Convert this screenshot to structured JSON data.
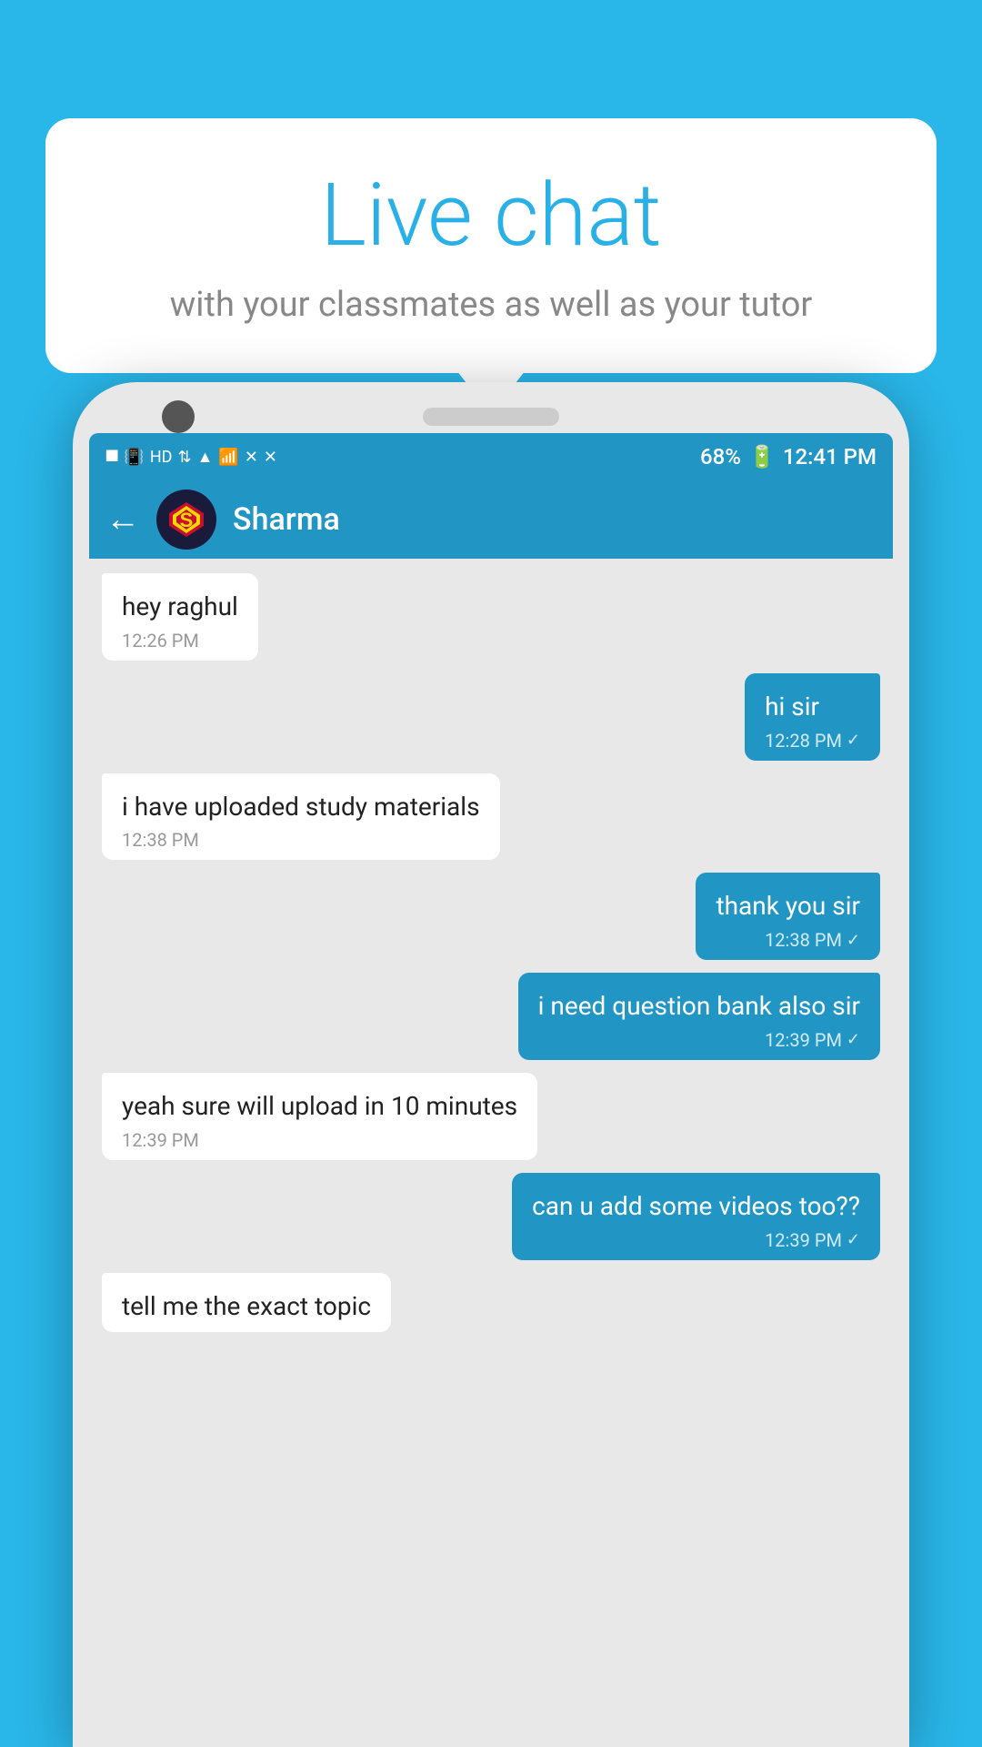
{
  "background_color": "#29b6e8",
  "speech_bubble": {
    "title": "Live chat",
    "subtitle": "with your classmates as well as your tutor"
  },
  "phone": {
    "status_bar": {
      "time": "12:41 PM",
      "battery": "68%",
      "icons": [
        "bluetooth",
        "vibrate",
        "HD",
        "wifi",
        "signal",
        "battery"
      ]
    },
    "chat_header": {
      "contact_name": "Sharma",
      "back_label": "←"
    },
    "messages": [
      {
        "id": 1,
        "type": "received",
        "text": "hey raghul",
        "time": "12:26 PM",
        "check": false
      },
      {
        "id": 2,
        "type": "sent",
        "text": "hi sir",
        "time": "12:28 PM",
        "check": true
      },
      {
        "id": 3,
        "type": "received",
        "text": "i have uploaded study materials",
        "time": "12:38 PM",
        "check": false
      },
      {
        "id": 4,
        "type": "sent",
        "text": "thank you sir",
        "time": "12:38 PM",
        "check": true
      },
      {
        "id": 5,
        "type": "sent",
        "text": "i need question bank also sir",
        "time": "12:39 PM",
        "check": true
      },
      {
        "id": 6,
        "type": "received",
        "text": "yeah sure will upload in 10 minutes",
        "time": "12:39 PM",
        "check": false
      },
      {
        "id": 7,
        "type": "sent",
        "text": "can u add some videos too??",
        "time": "12:39 PM",
        "check": true
      },
      {
        "id": 8,
        "type": "received",
        "text": "tell me the exact topic",
        "time": "",
        "partial": true
      }
    ]
  }
}
